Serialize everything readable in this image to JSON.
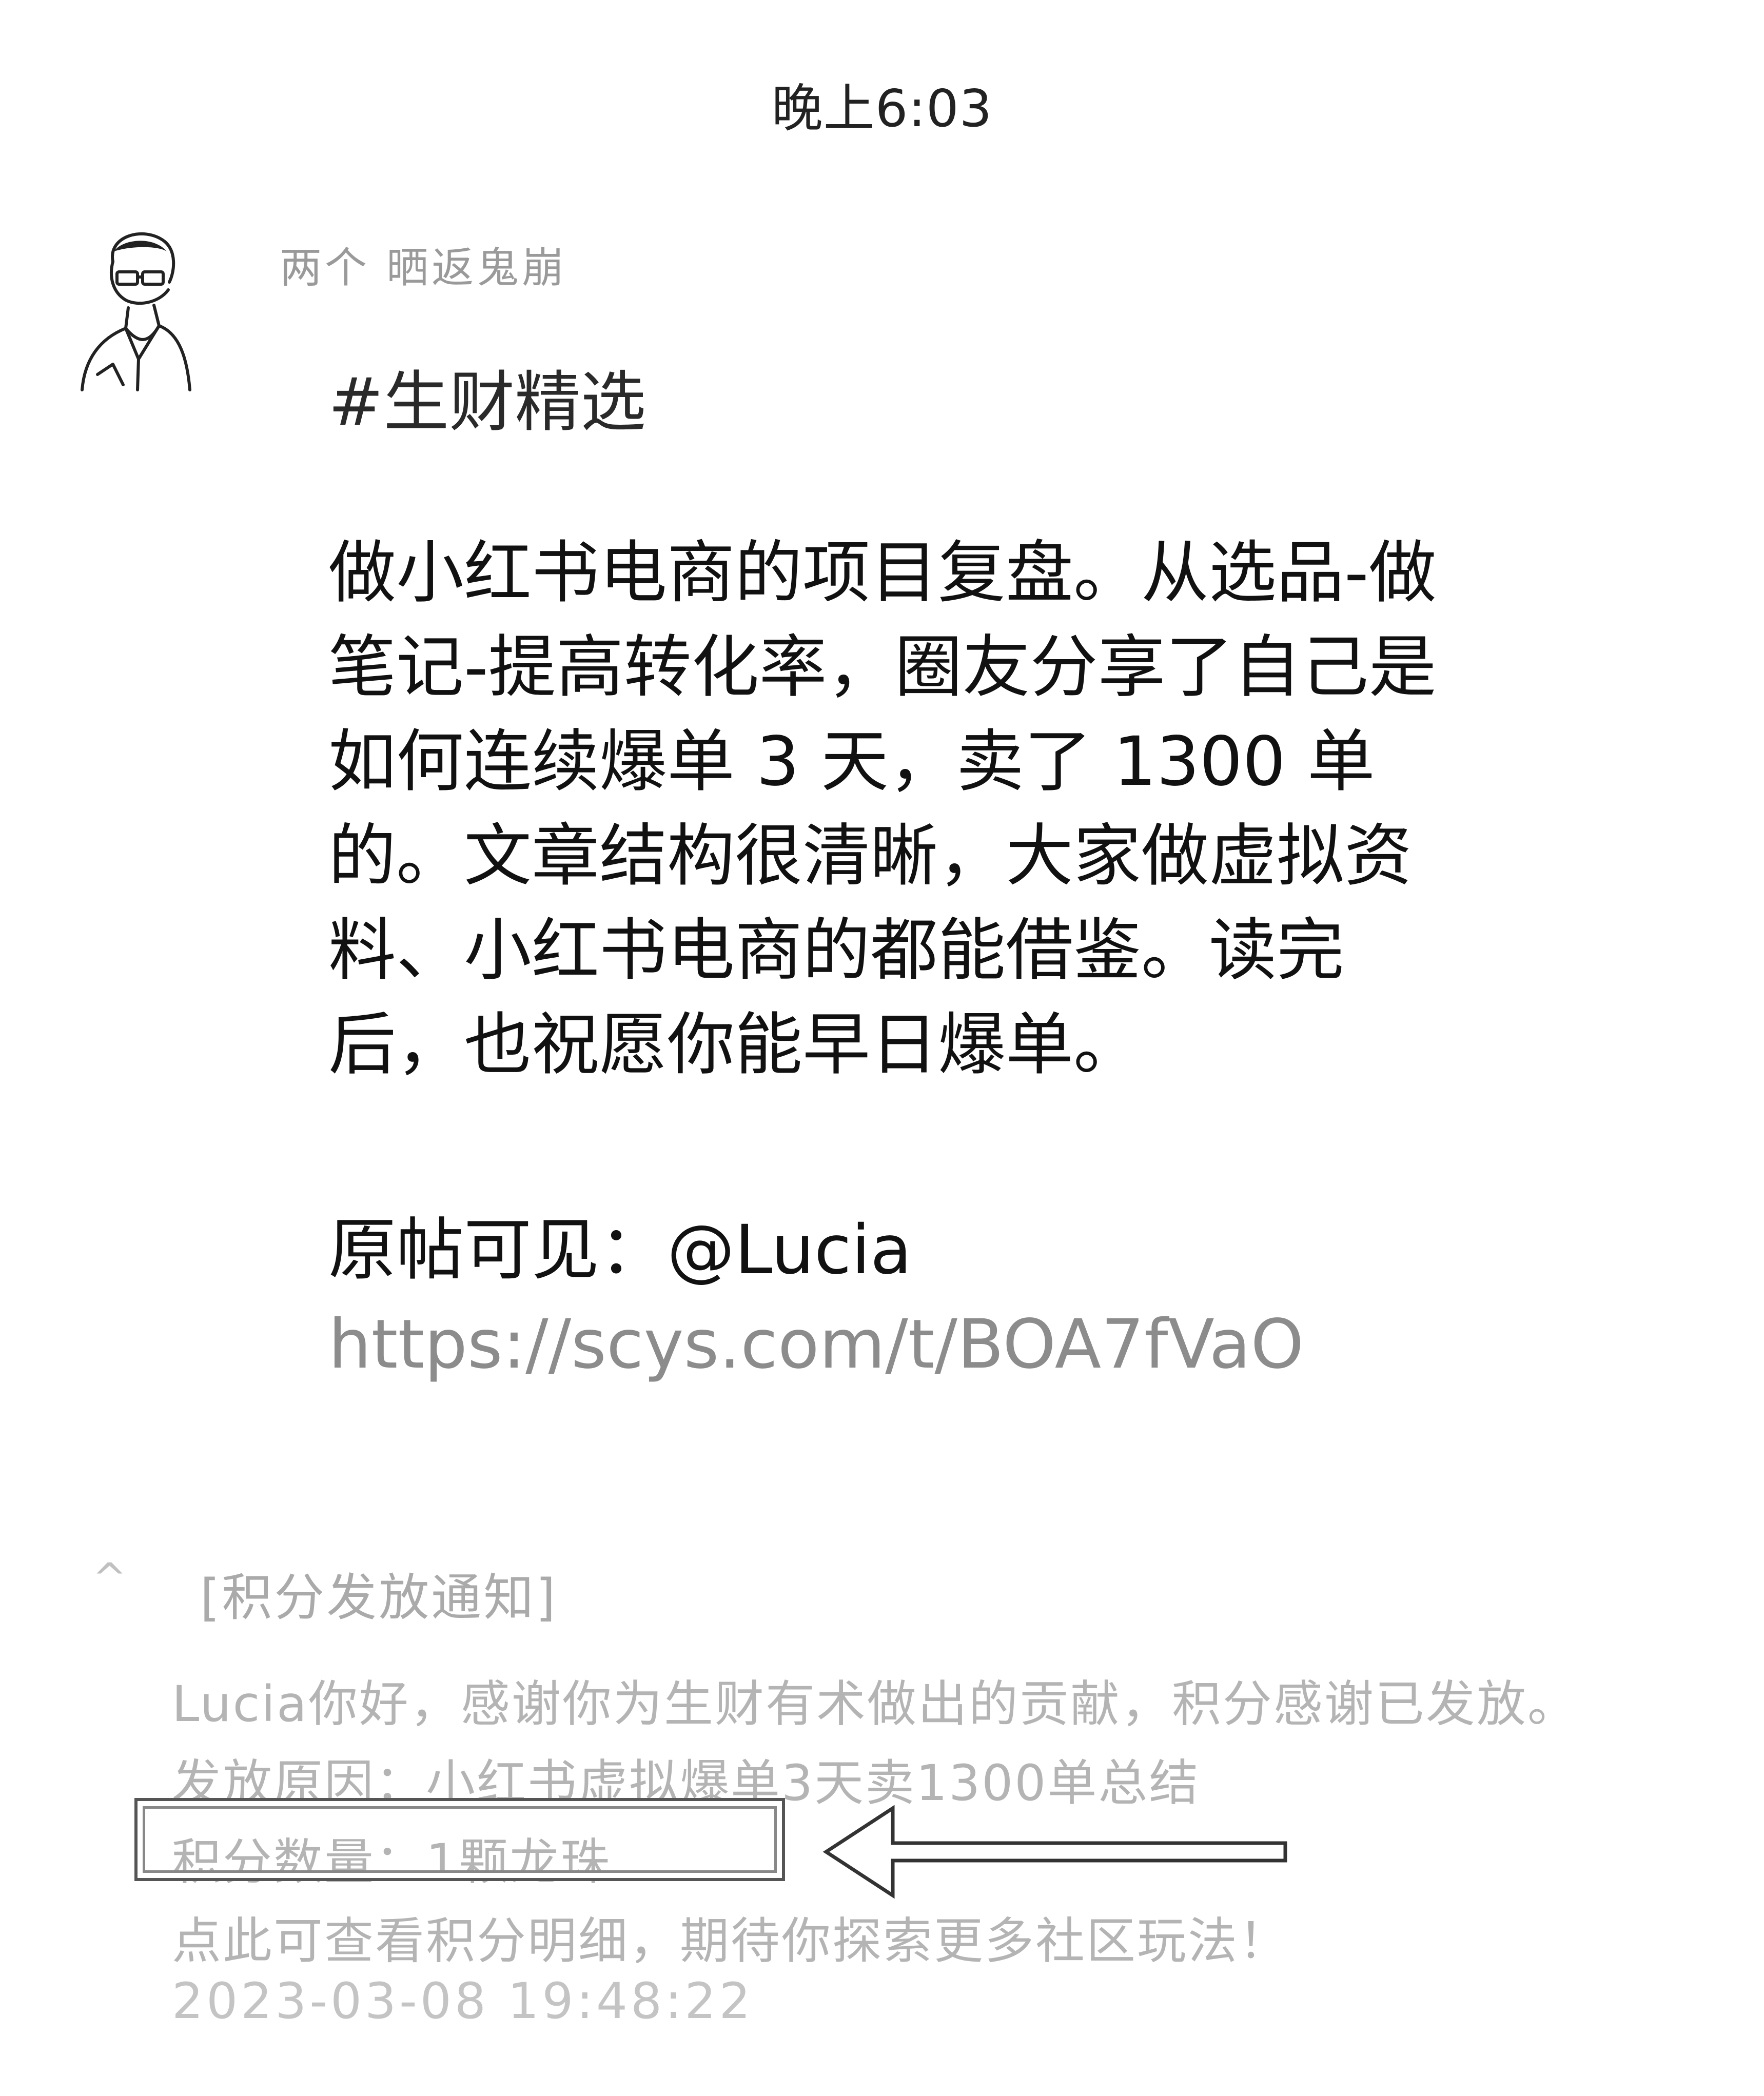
{
  "status_bar": {
    "time": "晚上6:03"
  },
  "message": {
    "sender_name": "两个   晒返鬼崩",
    "tag": "#生财精选",
    "body": "做小红书电商的项目复盘。从选品-做笔记-提高转化率，圈友分享了自己是如何连续爆单 3 天，卖了 1300 单的。文章结构很清晰，大家做虚拟资料、小红书电商的都能借鉴。读完后，也祝愿你能早日爆单。",
    "source_prefix": "原帖可见：@Lucia ",
    "source_link": "https://scys.com/t/BOA7fVaO"
  },
  "notification": {
    "title": "[积分发放通知]",
    "greeting": "Lucia你好，感谢你为生财有术做出的贡献，积分感谢已发放。",
    "reason": "发放原因：小红书虚拟爆单3天卖1300单总结",
    "amount": "积分数量：1颗龙珠",
    "cta": "点此可查看积分明细，期待你探索更多社区玩法！",
    "timestamp": "2023-03-08 19:48:22"
  },
  "icons": {
    "avatar": "user-avatar-icon",
    "arrow": "left-arrow-icon"
  }
}
